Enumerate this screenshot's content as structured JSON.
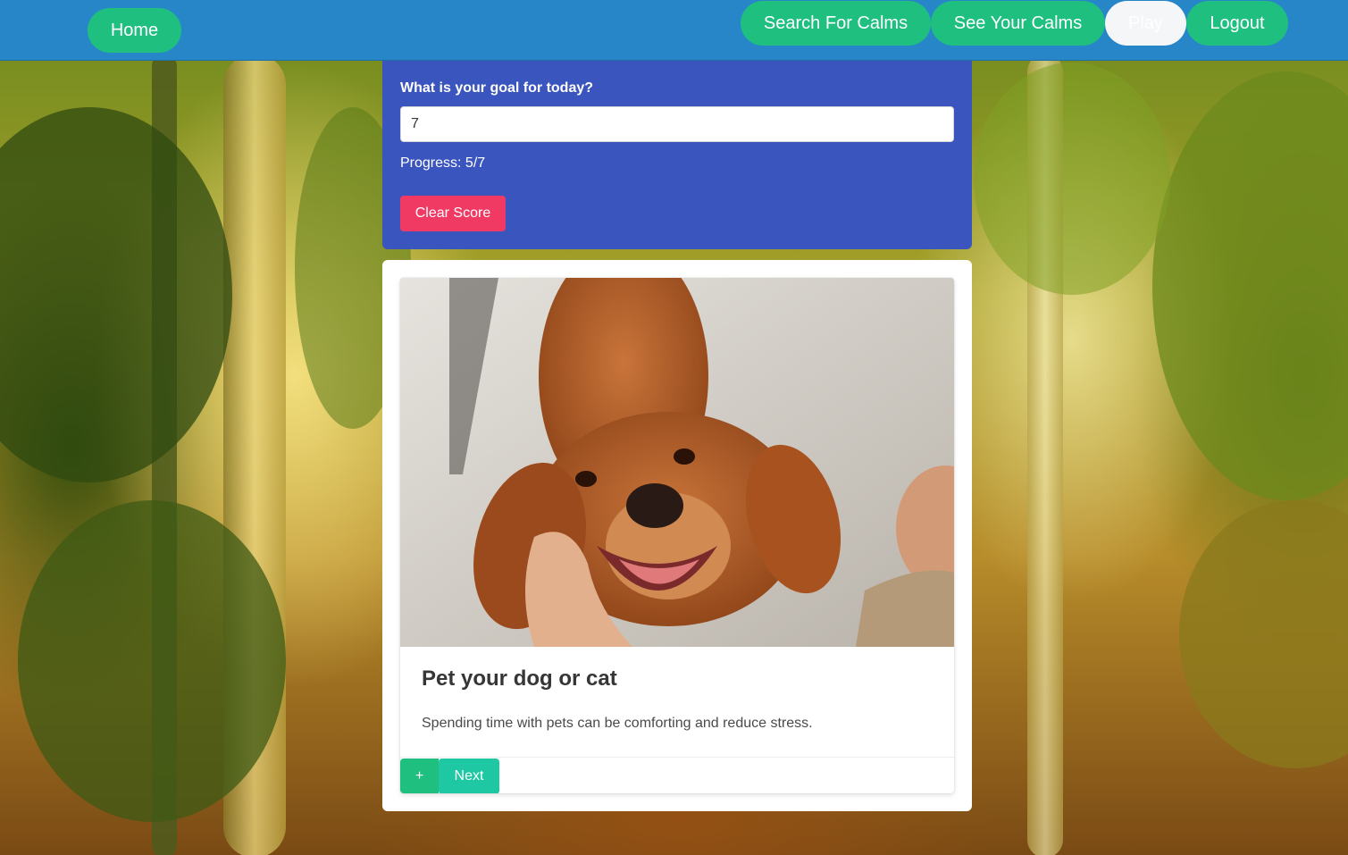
{
  "nav": {
    "home": "Home",
    "search": "Search For Calms",
    "see": "See Your Calms",
    "play": "Play",
    "logout": "Logout"
  },
  "goal": {
    "label": "What is your goal for today?",
    "value": "7",
    "progress": "Progress: 5/7",
    "clear_label": "Clear Score"
  },
  "card": {
    "image_subject": "golden retriever being petted",
    "title": "Pet your dog or cat",
    "description": "Spending time with pets can be comforting and reduce stress.",
    "plus_label": "+",
    "next_label": "Next"
  },
  "colors": {
    "navbar": "#2786c8",
    "nav_button": "#1fbf80",
    "goal_panel": "#3b55bf",
    "clear_button": "#f03a64",
    "next_button": "#1dc8a3"
  }
}
